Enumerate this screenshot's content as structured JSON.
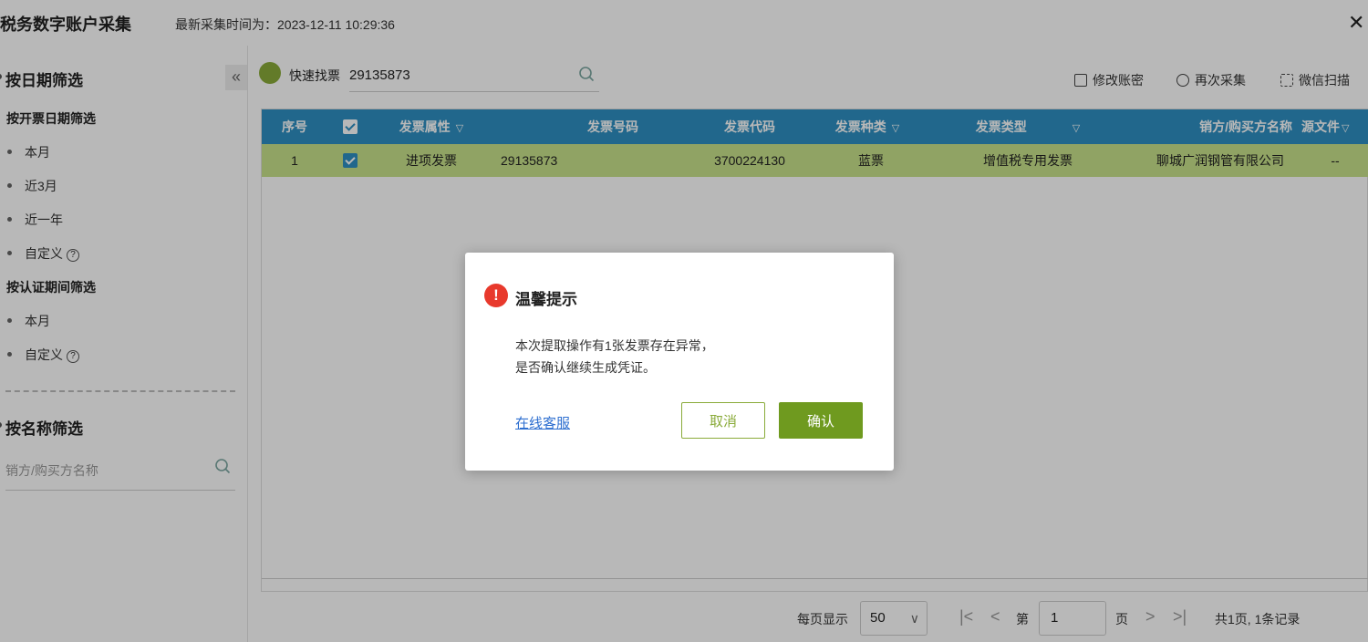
{
  "app": {
    "title": "税务数字账户采集",
    "last_collect": "最新采集时间为：2023-12-11 10:29:36",
    "close_glyph": "✕"
  },
  "sidebar": {
    "date_filter_heading": "按日期筛选",
    "collapse_glyph": "«",
    "invoice_date_group": "按开票日期筛选",
    "invoice_date_options": [
      "本月",
      "近3月",
      "近一年",
      "自定义"
    ],
    "cert_period_group": "按认证期间筛选",
    "cert_period_options": [
      "本月",
      "自定义"
    ],
    "help_glyph": "?",
    "name_filter_heading": "按名称筛选",
    "name_placeholder": "销方/购买方名称"
  },
  "toolbar": {
    "quick_find_label": "快速找票",
    "quick_find_value": "29135873",
    "edit_password": "修改账密",
    "recollect": "再次采集",
    "wechat_scan": "微信扫描"
  },
  "table": {
    "headers": {
      "seq": "序号",
      "attr": "发票属性",
      "number": "发票号码",
      "code": "发票代码",
      "kind": "发票种类",
      "type": "发票类型",
      "party": "销方/购买方名称",
      "source": "源文件"
    },
    "filter_glyph": "▽",
    "rows": [
      {
        "seq": "1",
        "checked": true,
        "attr": "进项发票",
        "number": "29135873",
        "code": "3700224130",
        "kind": "蓝票",
        "type": "增值税专用发票",
        "party": "聊城广润钢管有限公司",
        "source": "--"
      }
    ]
  },
  "pagination": {
    "per_page_label": "每页显示",
    "per_page_value": "50",
    "first_glyph": "|<",
    "prev_glyph": "<",
    "page_prefix": "第",
    "page_value": "1",
    "page_suffix": "页",
    "next_glyph": ">",
    "last_glyph": ">|",
    "summary": "共1页, 1条记录"
  },
  "dialog": {
    "warn_glyph": "!",
    "title": "温馨提示",
    "message_line1": "本次提取操作有1张发票存在异常，",
    "message_line2": "是否确认继续生成凭证。",
    "service_link": "在线客服",
    "cancel_label": "取消",
    "ok_label": "确认"
  },
  "colors": {
    "header_blue": "#2e8fc2",
    "row_green": "#c8e28b",
    "brand_green": "#6f9a1f",
    "warn_red": "#e8392c",
    "link_blue": "#2e6fd0"
  }
}
